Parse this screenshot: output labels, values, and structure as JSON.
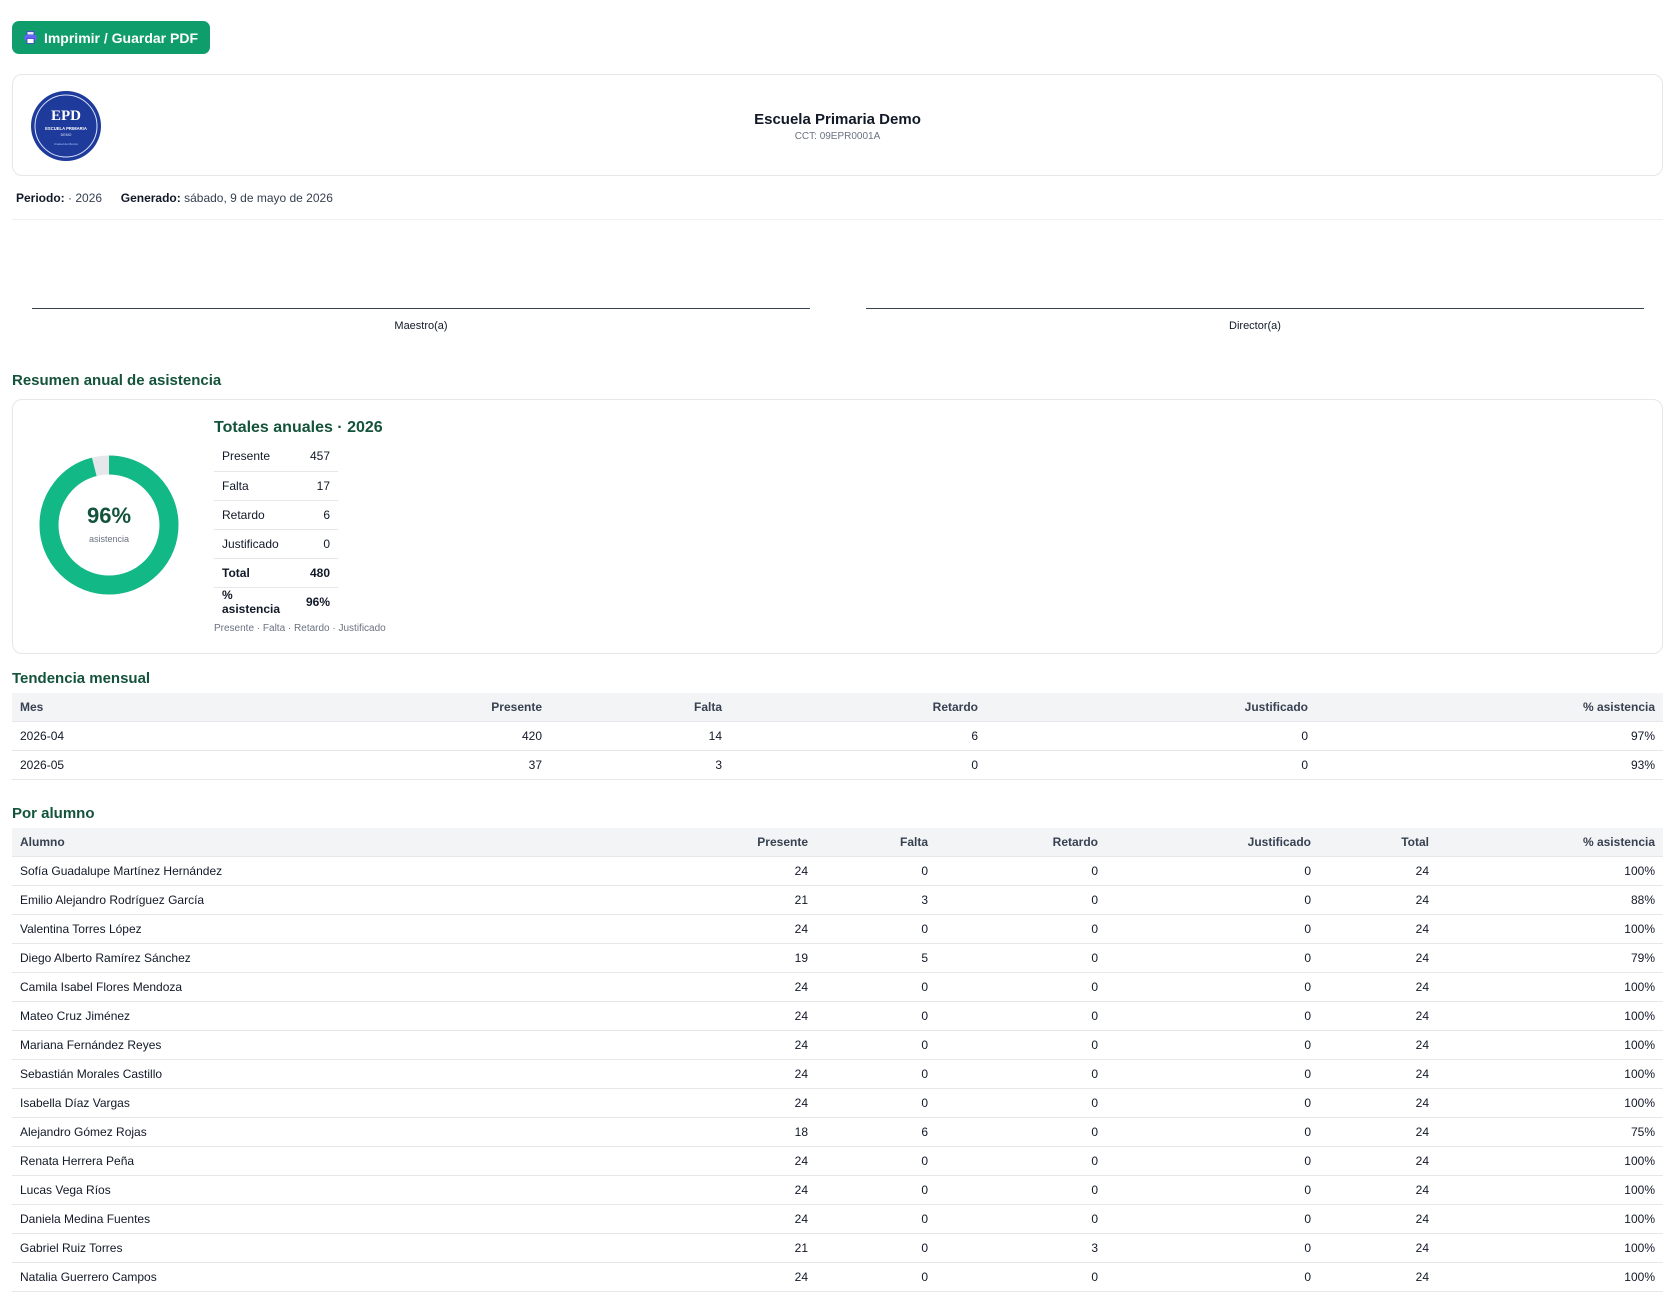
{
  "toolbar": {
    "print_label": "Imprimir / Guardar PDF"
  },
  "header": {
    "school_name": "Escuela Primaria Demo",
    "cct": "CCT: 09EPR0001A",
    "seal": {
      "initials": "EPD",
      "line1": "ESCUELA PRIMARIA",
      "line2": "DEMO",
      "line3": "Ciudad de Mexico"
    }
  },
  "meta": {
    "period_label": "Periodo:",
    "period_value": "· 2026",
    "generated_label": "Generado:",
    "generated_value": "sábado, 9 de mayo de 2026"
  },
  "signatures": {
    "teacher": "Maestro(a)",
    "director": "Director(a)"
  },
  "summary": {
    "section_title": "Resumen anual de asistencia",
    "totals_title": "Totales anuales · 2026",
    "donut_pct": "96%",
    "donut_label": "asistencia",
    "donut_fraction": 0.96,
    "rows": [
      {
        "label": "Presente",
        "value": "457"
      },
      {
        "label": "Falta",
        "value": "17"
      },
      {
        "label": "Retardo",
        "value": "6"
      },
      {
        "label": "Justificado",
        "value": "0"
      },
      {
        "label": "Total",
        "value": "480"
      },
      {
        "label": "% asistencia",
        "value": "96%"
      }
    ],
    "legend": "Presente · Falta · Retardo · Justificado"
  },
  "monthly": {
    "section_title": "Tendencia mensual",
    "headers": [
      "Mes",
      "Presente",
      "Falta",
      "Retardo",
      "Justificado",
      "% asistencia"
    ],
    "rows": [
      [
        "2026-04",
        "420",
        "14",
        "6",
        "0",
        "97%"
      ],
      [
        "2026-05",
        "37",
        "3",
        "0",
        "0",
        "93%"
      ]
    ]
  },
  "students": {
    "section_title": "Por alumno",
    "headers": [
      "Alumno",
      "Presente",
      "Falta",
      "Retardo",
      "Justificado",
      "Total",
      "% asistencia"
    ],
    "rows": [
      [
        "Sofía Guadalupe Martínez Hernández",
        "24",
        "0",
        "0",
        "0",
        "24",
        "100%"
      ],
      [
        "Emilio Alejandro Rodríguez García",
        "21",
        "3",
        "0",
        "0",
        "24",
        "88%"
      ],
      [
        "Valentina Torres López",
        "24",
        "0",
        "0",
        "0",
        "24",
        "100%"
      ],
      [
        "Diego Alberto Ramírez Sánchez",
        "19",
        "5",
        "0",
        "0",
        "24",
        "79%"
      ],
      [
        "Camila Isabel Flores Mendoza",
        "24",
        "0",
        "0",
        "0",
        "24",
        "100%"
      ],
      [
        "Mateo Cruz Jiménez",
        "24",
        "0",
        "0",
        "0",
        "24",
        "100%"
      ],
      [
        "Mariana Fernández Reyes",
        "24",
        "0",
        "0",
        "0",
        "24",
        "100%"
      ],
      [
        "Sebastián Morales Castillo",
        "24",
        "0",
        "0",
        "0",
        "24",
        "100%"
      ],
      [
        "Isabella Díaz Vargas",
        "24",
        "0",
        "0",
        "0",
        "24",
        "100%"
      ],
      [
        "Alejandro Gómez Rojas",
        "18",
        "6",
        "0",
        "0",
        "24",
        "75%"
      ],
      [
        "Renata Herrera Peña",
        "24",
        "0",
        "0",
        "0",
        "24",
        "100%"
      ],
      [
        "Lucas Vega Ríos",
        "24",
        "0",
        "0",
        "0",
        "24",
        "100%"
      ],
      [
        "Daniela Medina Fuentes",
        "24",
        "0",
        "0",
        "0",
        "24",
        "100%"
      ],
      [
        "Gabriel Ruiz Torres",
        "21",
        "0",
        "3",
        "0",
        "24",
        "100%"
      ],
      [
        "Natalia Guerrero Campos",
        "24",
        "0",
        "0",
        "0",
        "24",
        "100%"
      ]
    ]
  },
  "colors": {
    "brand": "#0f9d6b",
    "accent_dark": "#14533b",
    "donut": "#12b886",
    "seal": "#1e3a9a"
  }
}
